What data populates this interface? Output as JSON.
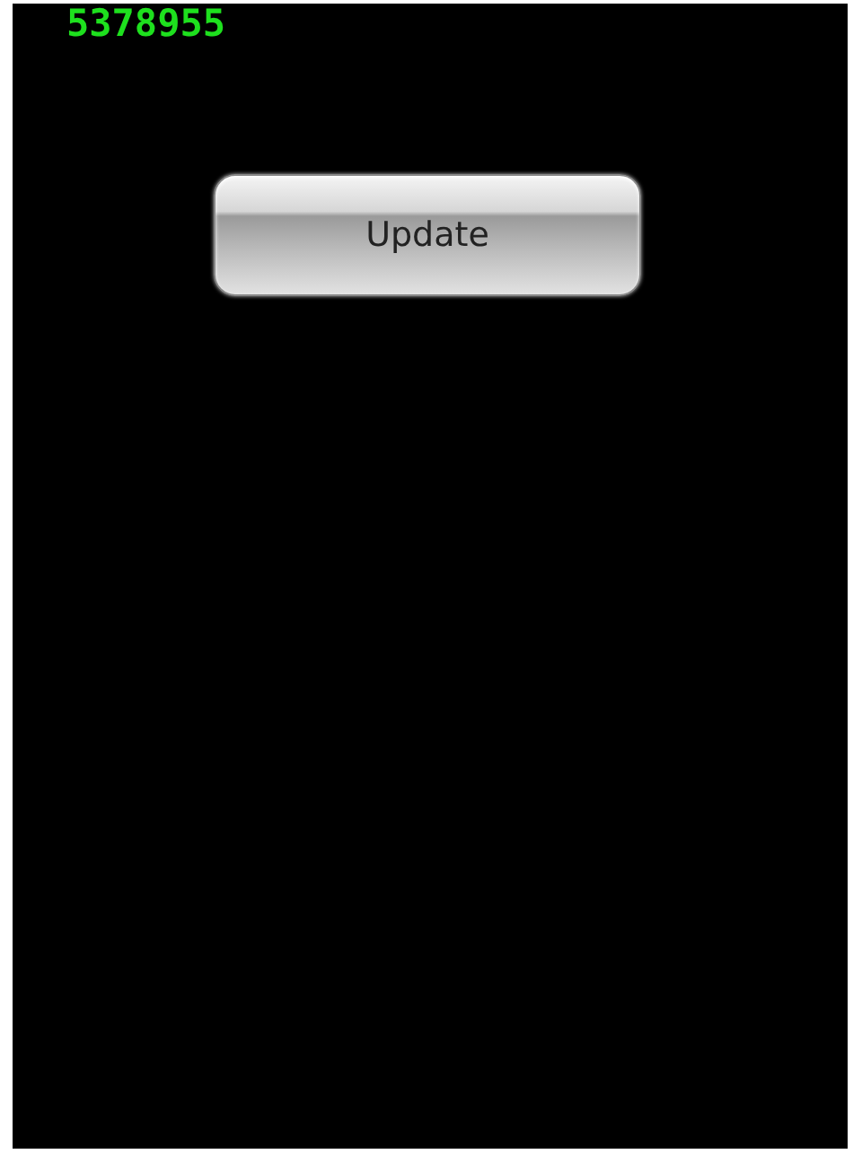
{
  "counter": "5378955",
  "button": {
    "label": "Update"
  }
}
